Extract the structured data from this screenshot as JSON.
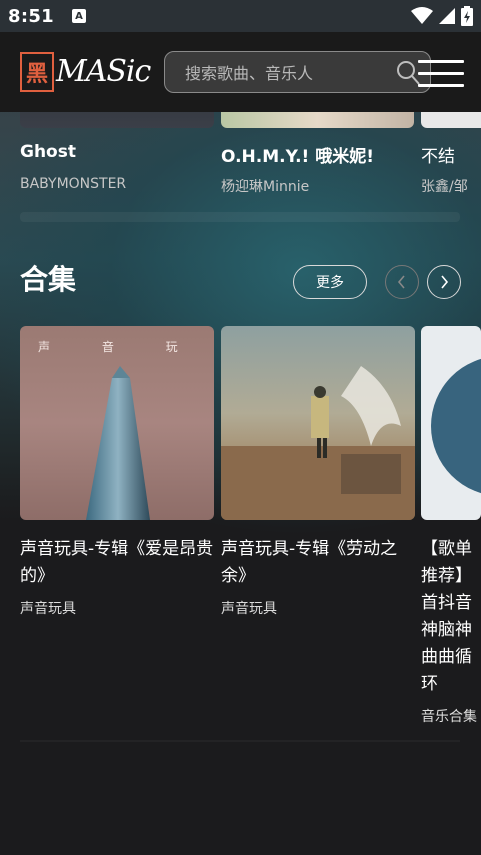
{
  "status_bar": {
    "time": "8:51",
    "a_badge": "A"
  },
  "header": {
    "logo_char": "黑",
    "logo_text": "MASic",
    "search_placeholder": "搜索歌曲、音乐人"
  },
  "songs": [
    {
      "title": "Ghost",
      "artist": "BABYMONSTER"
    },
    {
      "title": "O.H.M.Y.! 哦米妮!",
      "artist": "杨迎琳Minnie"
    },
    {
      "title": "不结",
      "artist": "张鑫/邹"
    }
  ],
  "collections": {
    "title": "合集",
    "more_label": "更多",
    "items": [
      {
        "title": "声音玩具-专辑《爱是昂贵的》",
        "artist": "声音玩具",
        "cover_text": "声 音 玩 具"
      },
      {
        "title": "声音玩具-专辑《劳动之余》",
        "artist": "声音玩具"
      },
      {
        "title": "【歌单推荐】首抖音神脑神曲曲循环",
        "artist": "音乐合集"
      }
    ]
  },
  "colors": {
    "accent": "#e0603f",
    "background": "#1b1b1d"
  }
}
